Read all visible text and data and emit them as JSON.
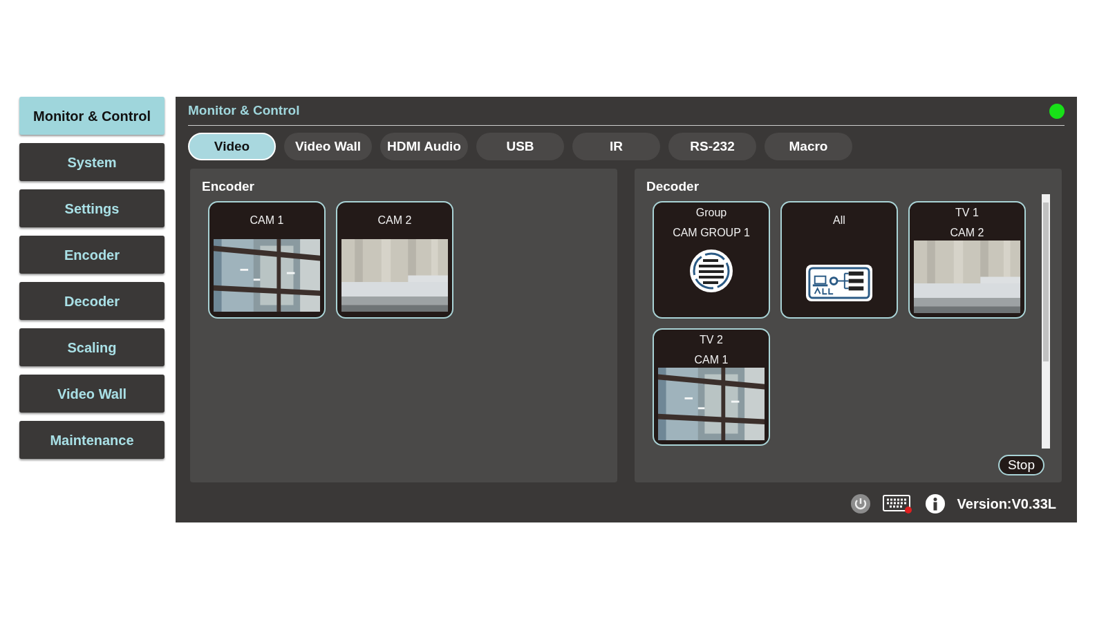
{
  "sidebar": {
    "items": [
      {
        "label": "Monitor & Control",
        "selected": true
      },
      {
        "label": "System",
        "selected": false
      },
      {
        "label": "Settings",
        "selected": false
      },
      {
        "label": "Encoder",
        "selected": false
      },
      {
        "label": "Decoder",
        "selected": false
      },
      {
        "label": "Scaling",
        "selected": false
      },
      {
        "label": "Video Wall",
        "selected": false
      },
      {
        "label": "Maintenance",
        "selected": false
      }
    ]
  },
  "panel": {
    "title": "Monitor & Control"
  },
  "tabs": [
    {
      "label": "Video",
      "selected": true
    },
    {
      "label": "Video Wall",
      "selected": false
    },
    {
      "label": "HDMI Audio",
      "selected": false
    },
    {
      "label": "USB",
      "selected": false
    },
    {
      "label": "IR",
      "selected": false
    },
    {
      "label": "RS-232",
      "selected": false
    },
    {
      "label": "Macro",
      "selected": false
    }
  ],
  "encoder": {
    "title": "Encoder",
    "tiles": [
      {
        "kind": "picture",
        "lines": [
          "CAM 1"
        ]
      },
      {
        "kind": "picture",
        "lines": [
          "CAM 2"
        ]
      }
    ]
  },
  "decoder": {
    "title": "Decoder",
    "tiles": [
      {
        "kind": "group",
        "lines": [
          "Group",
          "CAM GROUP 1"
        ]
      },
      {
        "kind": "all",
        "lines": [
          "All"
        ]
      },
      {
        "kind": "picture",
        "lines": [
          "TV 1",
          "CAM 2"
        ]
      },
      {
        "kind": "picture",
        "lines": [
          "TV 2",
          "CAM 1"
        ]
      }
    ],
    "stop_button": "Stop"
  },
  "footer": {
    "version": "Version:V0.33L"
  }
}
